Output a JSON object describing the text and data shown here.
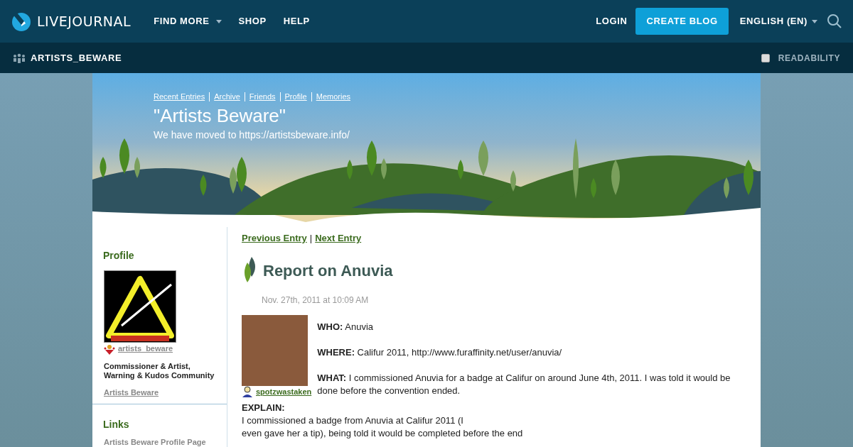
{
  "topbar": {
    "logo": "LIVEJOURNAL",
    "nav": [
      {
        "label": "FIND MORE",
        "dropdown": true
      },
      {
        "label": "SHOP",
        "dropdown": false
      },
      {
        "label": "HELP",
        "dropdown": false
      }
    ],
    "login": "LOGIN",
    "create_blog": "CREATE BLOG",
    "language": {
      "label": "ENGLISH (EN)",
      "dropdown": true
    }
  },
  "subbar": {
    "journal": "ARTISTS_BEWARE",
    "readability": {
      "label": "READABILITY",
      "checked": false
    }
  },
  "header": {
    "links": [
      "Recent Entries",
      "Archive",
      "Friends",
      "Profile",
      "Memories"
    ],
    "title": "\"Artists Beware\"",
    "subtitle": "We have moved to https://artistsbeware.info/"
  },
  "sidebar": {
    "profile": {
      "heading": "Profile",
      "username": "artists_beware",
      "description": "Commissioner & Artist, Warning & Kudos Community",
      "name_link": "Artists Beware"
    },
    "links": {
      "heading": "Links",
      "items": [
        "Artists Beware Profile Page"
      ]
    }
  },
  "entry": {
    "nav": [
      "Previous Entry",
      "Next Entry"
    ],
    "separator": "|",
    "title": "Report on Anuvia",
    "date": "Nov. 27th, 2011 at 10:09 AM",
    "poster": "spotzwastaken",
    "fields": [
      {
        "label": "WHO:",
        "text": "Anuvia"
      },
      {
        "label": "WHERE:",
        "text": "Califur 2011, http://www.furaffinity.net/user/anuvia/"
      },
      {
        "label": "WHAT:",
        "text": "I commissioned Anuvia for a badge at Califur on around June 4th, 2011. I was told it would be done before the convention ended."
      }
    ],
    "explain_label": "EXPLAIN:",
    "explain_lines": [
      "I commissioned a badge from Anuvia at Califur 2011 (I",
      "even gave her a tip), being told it would be completed before the end"
    ]
  }
}
